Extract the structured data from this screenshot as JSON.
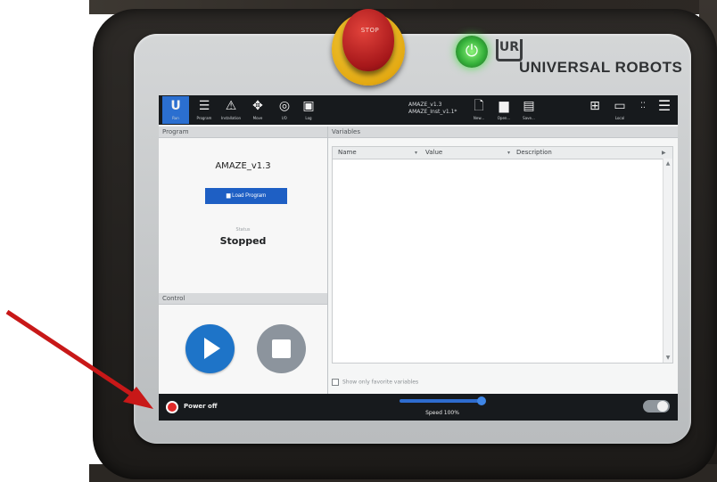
{
  "estop": {
    "label": "STOP"
  },
  "brand": {
    "logo": "UR",
    "name": "UNIVERSAL ROBOTS"
  },
  "toolbar": {
    "items": [
      {
        "label": "Run",
        "icon": "ur-run-icon"
      },
      {
        "label": "Program",
        "icon": "program-icon"
      },
      {
        "label": "Installation",
        "icon": "installation-icon"
      },
      {
        "label": "Move",
        "icon": "move-icon"
      },
      {
        "label": "I/O",
        "icon": "io-icon"
      },
      {
        "label": "Log",
        "icon": "log-icon"
      }
    ],
    "file_name": "AMAZE_v1.3",
    "installation_name": "AMAZE_Inst_v1.1*",
    "file_actions": [
      {
        "label": "New...",
        "icon": "new-file-icon"
      },
      {
        "label": "Open...",
        "icon": "open-folder-icon"
      },
      {
        "label": "Save...",
        "icon": "save-icon"
      }
    ],
    "local_label": "Local"
  },
  "program_panel": {
    "title": "Program",
    "program_name": "AMAZE_v1.3",
    "load_button": "Load Program",
    "status_label": "Status",
    "status_value": "Stopped"
  },
  "control_panel": {
    "title": "Control"
  },
  "variables_panel": {
    "title": "Variables",
    "columns": [
      "Name",
      "Value",
      "Description"
    ],
    "favorites_label": "Show only favorite variables"
  },
  "bottom_bar": {
    "power_label": "Power off",
    "speed_label": "Speed 100%",
    "speed_value": 1.0
  },
  "colors": {
    "accent": "#2b6fd0",
    "play": "#1e74c8",
    "power_off": "#e22a2a",
    "status_led": "#35b13a"
  }
}
